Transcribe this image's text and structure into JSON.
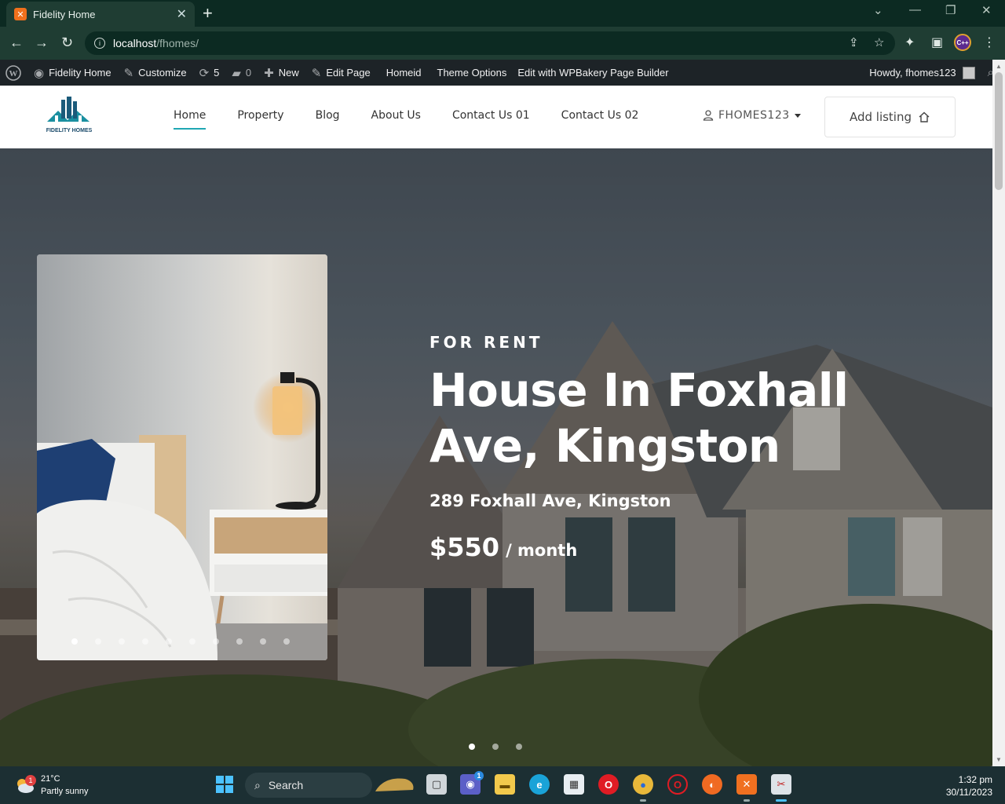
{
  "browser": {
    "tab_title": "Fidelity Home",
    "tab_favicon": "xampp-icon",
    "url_host": "localhost",
    "url_path": "/fhomes/",
    "extension_badge": "C++"
  },
  "adminbar": {
    "site_name": "Fidelity Home",
    "customize": "Customize",
    "updates_count": "5",
    "comments_count": "0",
    "new": "New",
    "edit_page": "Edit Page",
    "homeid": "Homeid",
    "theme_options": "Theme Options",
    "wpbakery": "Edit with WPBakery Page Builder",
    "howdy": "Howdy, fhomes123"
  },
  "header": {
    "logo_text": "FIDELITY HOMES",
    "nav": [
      "Home",
      "Property",
      "Blog",
      "About Us",
      "Contact Us 01",
      "Contact Us 02"
    ],
    "active_nav": "Home",
    "user": "FHOMES123",
    "add_listing": "Add listing"
  },
  "hero": {
    "status": "FOR RENT",
    "title": "House In Foxhall Ave, Kingston",
    "address": "289 Foxhall Ave, Kingston",
    "price": "$550",
    "period": "/ month",
    "card_slide_count": 10,
    "card_active_slide": 1,
    "hero_slide_count": 3,
    "hero_active_slide": 1
  },
  "taskbar": {
    "weather_temp": "21°C",
    "weather_desc": "Partly sunny",
    "weather_badge": "1",
    "search_label": "Search",
    "teams_badge": "1",
    "time": "1:32 pm",
    "date": "30/11/2023"
  },
  "colors": {
    "accent": "#1fa7b3",
    "adminbar_bg": "#1d2327",
    "browser_bg": "#1f3d33"
  }
}
